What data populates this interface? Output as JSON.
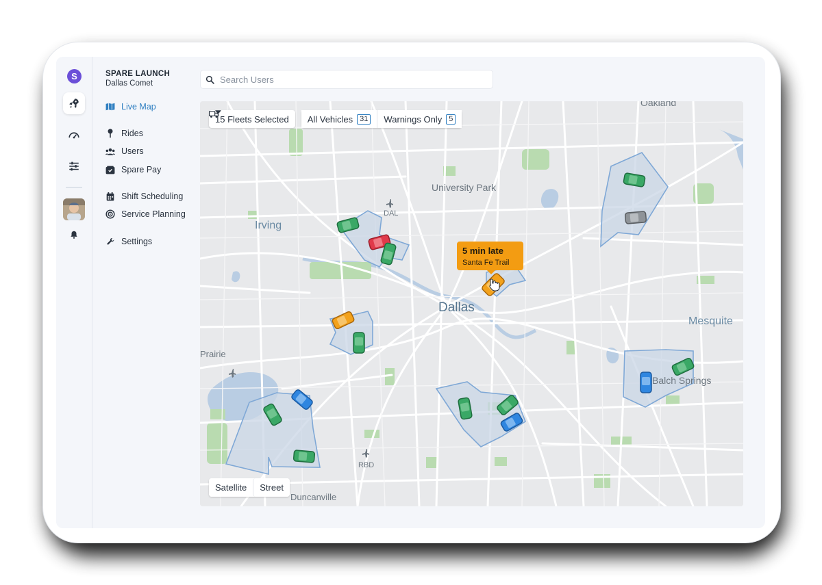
{
  "app": {
    "brand_letter": "S",
    "org_title": "SPARE LAUNCH",
    "org_subtitle": "Dallas Comet"
  },
  "rail_icons": [
    "rocket-icon",
    "gauge-icon",
    "sliders-icon",
    "bell-icon"
  ],
  "nav": {
    "items": [
      {
        "label": "Live Map",
        "icon": "map-icon",
        "active": true
      },
      {
        "label": "Rides",
        "icon": "pin-icon"
      },
      {
        "label": "Users",
        "icon": "users-icon"
      },
      {
        "label": "Spare Pay",
        "icon": "wallet-icon"
      },
      {
        "label": "Shift Scheduling",
        "icon": "calendar-icon"
      },
      {
        "label": "Service Planning",
        "icon": "target-icon"
      },
      {
        "label": "Settings",
        "icon": "wrench-icon"
      }
    ]
  },
  "search": {
    "placeholder": "Search Users",
    "value": ""
  },
  "toolbar": {
    "fleets_label": "15 Fleets Selected",
    "all_vehicles_label": "All Vehicles",
    "all_vehicles_count": "31",
    "warnings_label": "Warnings Only",
    "warnings_count": "5"
  },
  "map_type": {
    "satellite": "Satellite",
    "street": "Street"
  },
  "tooltip": {
    "title": "5 min late",
    "subtitle": "Santa Fe Trail"
  },
  "map_labels": {
    "oakland": "Oakland",
    "university_park": "University Park",
    "irving": "Irving",
    "dal": "DAL",
    "dallas": "Dallas",
    "mesquite": "Mesquite",
    "prairie": "Prairie",
    "balch_springs": "Balch Springs",
    "rbd": "RBD",
    "duncanville": "Duncanville"
  },
  "colors": {
    "accent": "#2f7fc1",
    "brand": "#6b4fd8",
    "vehicle_green": "#3aa866",
    "vehicle_red": "#e03a4a",
    "vehicle_orange": "#f3a21c",
    "vehicle_blue": "#2f86e0",
    "vehicle_gray": "#8e9398",
    "zone_fill": "#c9d6e6",
    "zone_stroke": "#7fa8d6"
  }
}
